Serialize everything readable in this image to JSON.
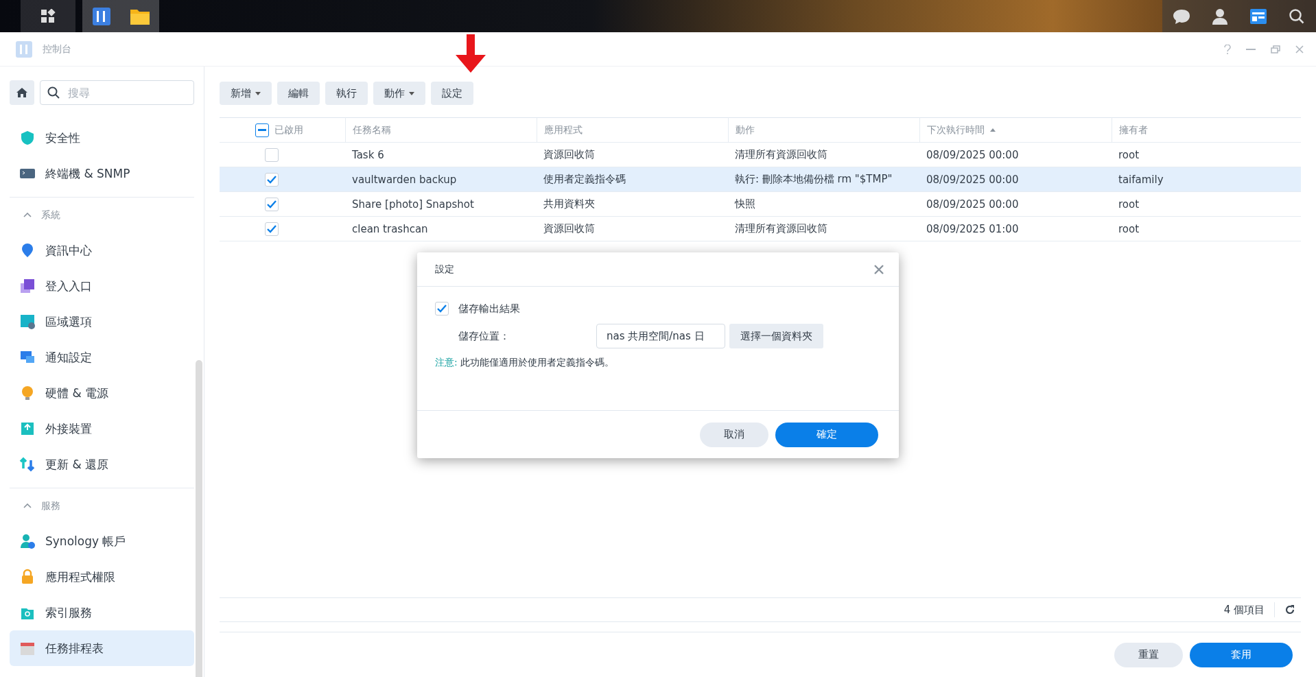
{
  "window": {
    "title": "控制台"
  },
  "sidebar": {
    "search": {
      "placeholder": "搜尋"
    },
    "groups": [
      {
        "items": [
          {
            "label": "安全性",
            "selected": false
          },
          {
            "label": "終端機 & SNMP",
            "selected": false
          }
        ]
      },
      {
        "title": "系統",
        "expanded": true,
        "items": [
          {
            "label": "資訊中心",
            "selected": false
          },
          {
            "label": "登入入口",
            "selected": false
          },
          {
            "label": "區域選項",
            "selected": false
          },
          {
            "label": "通知設定",
            "selected": false
          },
          {
            "label": "硬體 & 電源",
            "selected": false
          },
          {
            "label": "外接裝置",
            "selected": false
          },
          {
            "label": "更新 & 還原",
            "selected": false
          }
        ]
      },
      {
        "title": "服務",
        "expanded": true,
        "items": [
          {
            "label": "Synology 帳戶",
            "selected": false
          },
          {
            "label": "應用程式權限",
            "selected": false
          },
          {
            "label": "索引服務",
            "selected": false
          },
          {
            "label": "任務排程表",
            "selected": true
          }
        ]
      }
    ]
  },
  "toolbar": [
    {
      "label": "新增",
      "dropdown": true
    },
    {
      "label": "編輯",
      "dropdown": false
    },
    {
      "label": "執行",
      "dropdown": false
    },
    {
      "label": "動作",
      "dropdown": true
    },
    {
      "label": "設定",
      "dropdown": false
    }
  ],
  "table": {
    "enabled_column": {
      "label": "已啟用",
      "select_all_indeterminate": true
    },
    "columns": [
      {
        "label": "任務名稱",
        "sorted": false
      },
      {
        "label": "應用程式",
        "sorted": false
      },
      {
        "label": "動作",
        "sorted": false
      },
      {
        "label": "下次執行時間",
        "sorted": true
      },
      {
        "label": "擁有者",
        "sorted": false
      }
    ],
    "rows": [
      {
        "enabled": false,
        "selected": false,
        "cells": [
          "Task 6",
          "資源回收筒",
          "清理所有資源回收筒",
          "08/09/2025 00:00",
          "root"
        ]
      },
      {
        "enabled": true,
        "selected": true,
        "cells": [
          "vaultwarden backup",
          "使用者定義指令碼",
          "執行: 刪除本地備份檔 rm \"$TMP\"",
          "08/09/2025 00:00",
          "taifamily"
        ]
      },
      {
        "enabled": true,
        "selected": false,
        "cells": [
          "Share [photo] Snapshot",
          "共用資料夾",
          "快照",
          "08/09/2025 00:00",
          "root"
        ]
      },
      {
        "enabled": true,
        "selected": false,
        "cells": [
          "clean trashcan",
          "資源回收筒",
          "清理所有資源回收筒",
          "08/09/2025 01:00",
          "root"
        ]
      }
    ]
  },
  "status_bar": {
    "count": "4 個項目"
  },
  "footer_buttons": [
    {
      "label": "重置",
      "primary": false
    },
    {
      "label": "套用",
      "primary": true
    }
  ],
  "dialog": {
    "title": "設定",
    "save_output": {
      "label": "儲存輸出結果",
      "checked": true
    },
    "location": {
      "label": "儲存位置：",
      "value": "nas 共用空間/nas 日",
      "button": "選擇一個資料夾"
    },
    "note": {
      "label": "注意:",
      "text": "此功能僅適用於使用者定義指令碼。"
    },
    "buttons": [
      {
        "label": "取消",
        "primary": false
      },
      {
        "label": "確定",
        "primary": true
      }
    ]
  }
}
